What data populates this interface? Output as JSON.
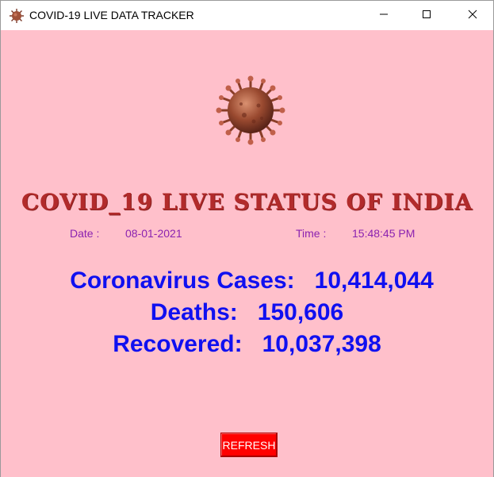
{
  "window": {
    "title": "COVID-19 LIVE DATA TRACKER",
    "icon": "virus-icon"
  },
  "controls": {
    "minimize": "minimize-icon",
    "maximize": "maximize-icon",
    "close": "close-icon"
  },
  "colors": {
    "background": "#ffc0cb",
    "headline": "#b22b2b",
    "meta": "#8b22b0",
    "stats": "#1010f0",
    "refresh_button": "#ff0000"
  },
  "headline": "COVID_19 LIVE STATUS OF INDIA",
  "date": {
    "label": "Date :",
    "value": "08-01-2021"
  },
  "time": {
    "label": "Time :",
    "value": "15:48:45  PM"
  },
  "stats": {
    "cases": {
      "label": "Coronavirus Cases:",
      "value": "10,414,044"
    },
    "deaths": {
      "label": "Deaths:",
      "value": "150,606"
    },
    "recovered": {
      "label": "Recovered:",
      "value": "10,037,398"
    }
  },
  "refresh_label": "REFRESH"
}
